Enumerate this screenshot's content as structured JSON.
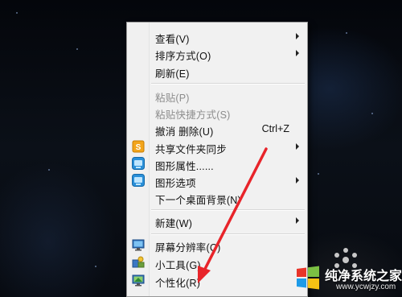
{
  "context_menu": {
    "items": [
      {
        "label": "查看(V)",
        "submenu": true,
        "disabled": false
      },
      {
        "label": "排序方式(O)",
        "submenu": true,
        "disabled": false
      },
      {
        "label": "刷新(E)",
        "submenu": false,
        "disabled": false
      },
      {
        "label": "粘贴(P)",
        "submenu": false,
        "disabled": true
      },
      {
        "label": "粘贴快捷方式(S)",
        "submenu": false,
        "disabled": true
      },
      {
        "label": "撤消 删除(U)",
        "shortcut": "Ctrl+Z",
        "submenu": false,
        "disabled": false
      },
      {
        "label": "共享文件夹同步",
        "icon": "sync-folder-icon",
        "submenu": true,
        "disabled": false
      },
      {
        "label": "图形属性......",
        "icon": "graphics-properties-icon",
        "submenu": false,
        "disabled": false
      },
      {
        "label": "图形选项",
        "icon": "graphics-options-icon",
        "submenu": true,
        "disabled": false
      },
      {
        "label": "下一个桌面背景(N)",
        "submenu": false,
        "disabled": false
      },
      {
        "label": "新建(W)",
        "submenu": true,
        "disabled": false
      },
      {
        "label": "屏幕分辨率(C)",
        "icon": "screen-resolution-icon",
        "submenu": false,
        "disabled": false
      },
      {
        "label": "小工具(G)",
        "icon": "gadgets-icon",
        "submenu": false,
        "disabled": false
      },
      {
        "label": "个性化(R)",
        "icon": "personalize-icon",
        "submenu": false,
        "disabled": false
      }
    ]
  },
  "annotation": {
    "color": "#e8242a"
  },
  "watermark": {
    "title": "纯净系统之家",
    "url": "www.ycwjzy.com"
  },
  "colors": {
    "menu_background": "#f1f1f1",
    "disabled_text": "#8c8c8c"
  }
}
